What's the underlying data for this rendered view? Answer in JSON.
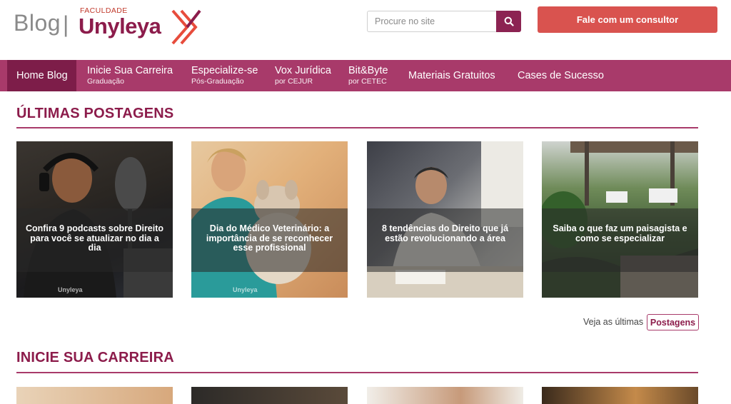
{
  "header": {
    "blog_label": "Blog",
    "separator": "|",
    "faculdade_label": "FACULDADE",
    "brand_name": "Unyleya",
    "search_placeholder": "Procure no site",
    "cta_label": "Fale com um consultor"
  },
  "nav": {
    "items": [
      {
        "label": "Home Blog",
        "sub": ""
      },
      {
        "label": "Inicie Sua Carreira",
        "sub": "Graduação"
      },
      {
        "label": "Especialize-se",
        "sub": "Pós-Graduação"
      },
      {
        "label": "Vox Jurídica",
        "sub": "por CEJUR"
      },
      {
        "label": "Bit&Byte",
        "sub": "por CETEC"
      },
      {
        "label": "Materiais Gratuitos",
        "sub": ""
      },
      {
        "label": "Cases de Sucesso",
        "sub": ""
      }
    ]
  },
  "latest": {
    "title": "ÚLTIMAS POSTAGENS",
    "posts": [
      {
        "title": "Confira 9 podcasts sobre Direito para você se atualizar no dia a dia",
        "watermark": "Unyleya"
      },
      {
        "title": "Dia do Médico Veterinário: a importância de se reconhecer esse profissional",
        "watermark": "Unyleya"
      },
      {
        "title": "8 tendências do Direito que já estão revolucionando a área",
        "watermark": ""
      },
      {
        "title": "Saiba o que faz um paisagista e como se especializar",
        "watermark": ""
      }
    ],
    "see_more_text": "Veja as últimas",
    "see_more_button": "Postagens"
  },
  "career": {
    "title": "INICIE SUA CARREIRA"
  },
  "colors": {
    "brand": "#8c1c4b",
    "nav": "#a83a6a",
    "nav_active": "#7d1d49",
    "cta": "#d9534f"
  }
}
